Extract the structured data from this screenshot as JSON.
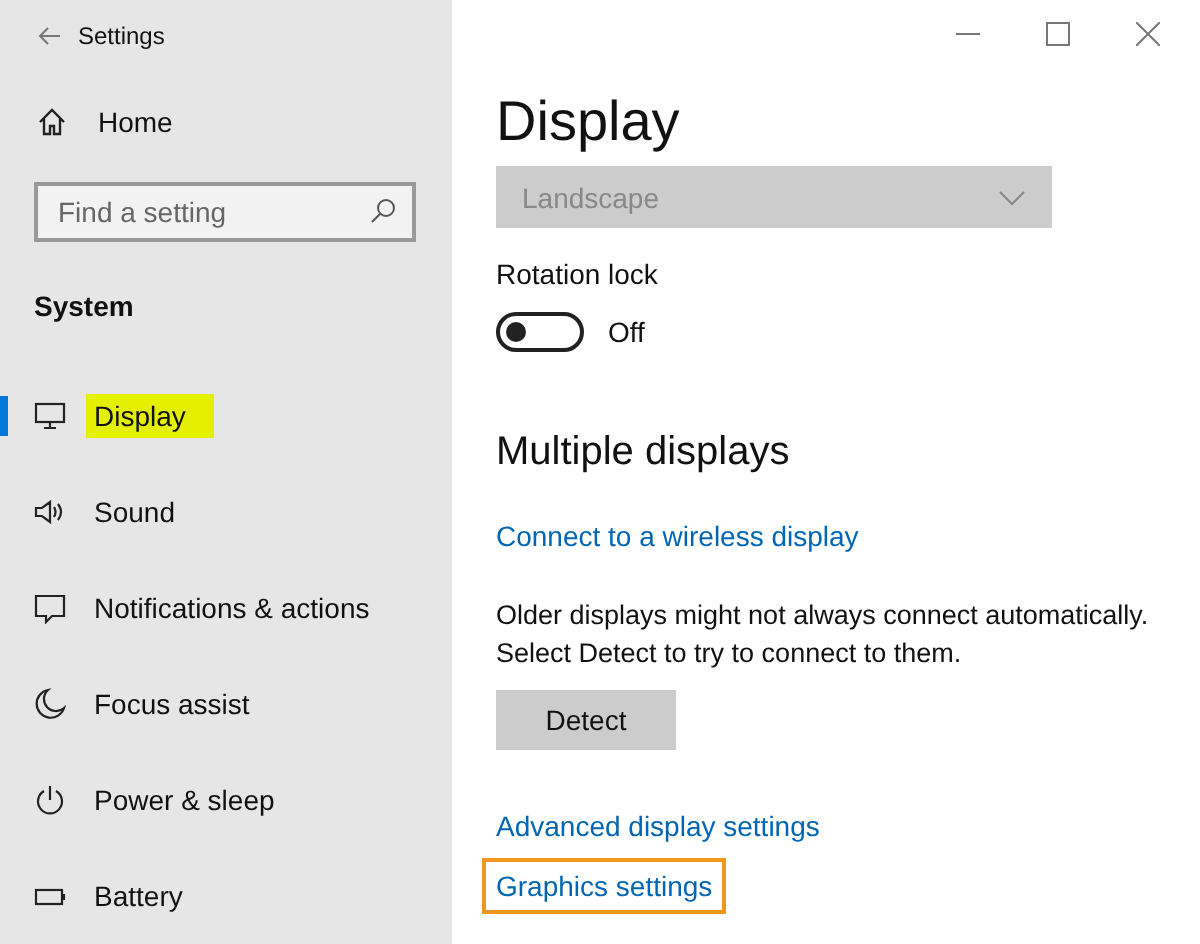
{
  "window": {
    "title": "Settings"
  },
  "sidebar": {
    "home": "Home",
    "search": {
      "placeholder": "Find a setting"
    },
    "section": "System",
    "items": [
      {
        "label": "Display",
        "selected": true,
        "highlighted": true
      },
      {
        "label": "Sound",
        "selected": false,
        "highlighted": false
      },
      {
        "label": "Notifications & actions",
        "selected": false,
        "highlighted": false
      },
      {
        "label": "Focus assist",
        "selected": false,
        "highlighted": false
      },
      {
        "label": "Power & sleep",
        "selected": false,
        "highlighted": false
      },
      {
        "label": "Battery",
        "selected": false,
        "highlighted": false
      }
    ]
  },
  "main": {
    "title": "Display",
    "orientation": {
      "value": "Landscape",
      "disabled": true
    },
    "rotation_lock": {
      "label": "Rotation lock",
      "on": false,
      "state_text": "Off"
    },
    "multiple_displays": {
      "heading": "Multiple displays",
      "connect_link": "Connect to a wireless display",
      "note_lines": [
        "Older displays might not always connect automatically.",
        "Select Detect to try to connect to them."
      ],
      "detect_button": "Detect"
    },
    "links": [
      {
        "label": "Advanced display settings",
        "outlined": false
      },
      {
        "label": "Graphics settings",
        "outlined": true
      }
    ]
  }
}
